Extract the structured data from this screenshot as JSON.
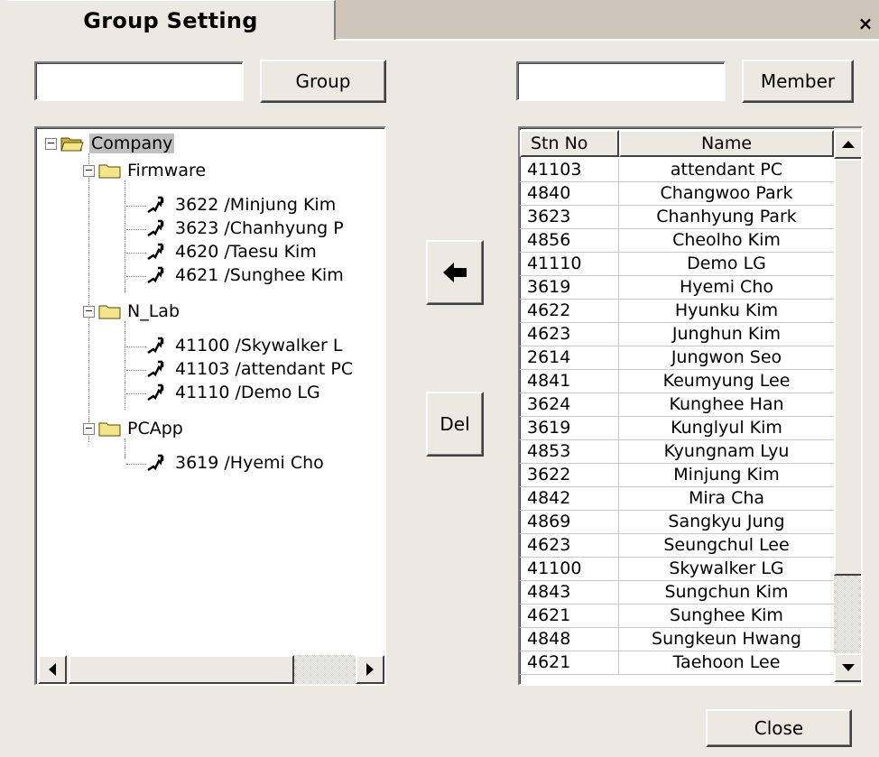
{
  "window": {
    "title": "Group Setting",
    "close_glyph": "×"
  },
  "group_panel": {
    "search_value": "",
    "button_label": "Group",
    "tree": {
      "root": {
        "label": "Company",
        "expander": "−",
        "icon": "open-folder-icon"
      },
      "groups": [
        {
          "label": "Firmware",
          "expander": "−",
          "icon": "folder-icon",
          "members": [
            "3622 /Minjung Kim",
            "3623 /Chanhyung P",
            "4620 /Taesu Kim",
            "4621 /Sunghee Kim"
          ]
        },
        {
          "label": "N_Lab",
          "expander": "−",
          "icon": "folder-icon",
          "members": [
            "41100 /Skywalker L",
            "41103 /attendant PC",
            "41110 /Demo  LG"
          ]
        },
        {
          "label": "PCApp",
          "expander": "−",
          "icon": "folder-icon",
          "members": [
            "3619 /Hyemi Cho"
          ]
        }
      ]
    }
  },
  "actions": {
    "add_glyph": "arrow-left-icon",
    "delete_label": "Del"
  },
  "member_panel": {
    "search_value": "",
    "button_label": "Member",
    "columns": [
      "Stn No",
      "Name"
    ],
    "rows": [
      [
        "41103",
        "attendant PC"
      ],
      [
        "4840",
        "Changwoo Park"
      ],
      [
        "3623",
        "Chanhyung Park"
      ],
      [
        "4856",
        "Cheolho Kim"
      ],
      [
        "41110",
        "Demo  LG"
      ],
      [
        "3619",
        "Hyemi Cho"
      ],
      [
        "4622",
        "Hyunku Kim"
      ],
      [
        "4623",
        "Junghun Kim"
      ],
      [
        "2614",
        "Jungwon Seo"
      ],
      [
        "4841",
        "Keumyung Lee"
      ],
      [
        "3624",
        "Kunghee Han"
      ],
      [
        "3619",
        "Kunglyul Kim"
      ],
      [
        "4853",
        "Kyungnam Lyu"
      ],
      [
        "3622",
        "Minjung Kim"
      ],
      [
        "4842",
        "Mira Cha"
      ],
      [
        "4869",
        "Sangkyu Jung"
      ],
      [
        "4623",
        "Seungchul Lee"
      ],
      [
        "41100",
        "Skywalker LG"
      ],
      [
        "4843",
        "Sungchun Kim"
      ],
      [
        "4621",
        "Sunghee Kim"
      ],
      [
        "4848",
        "Sungkeun Hwang"
      ],
      [
        "4621",
        "Taehoon Lee"
      ]
    ]
  },
  "footer": {
    "close_label": "Close"
  },
  "colors": {
    "dialog_bg": "#ece9e2",
    "tab_strip": "#cdc6b8",
    "selection": "#c0c0c0"
  }
}
